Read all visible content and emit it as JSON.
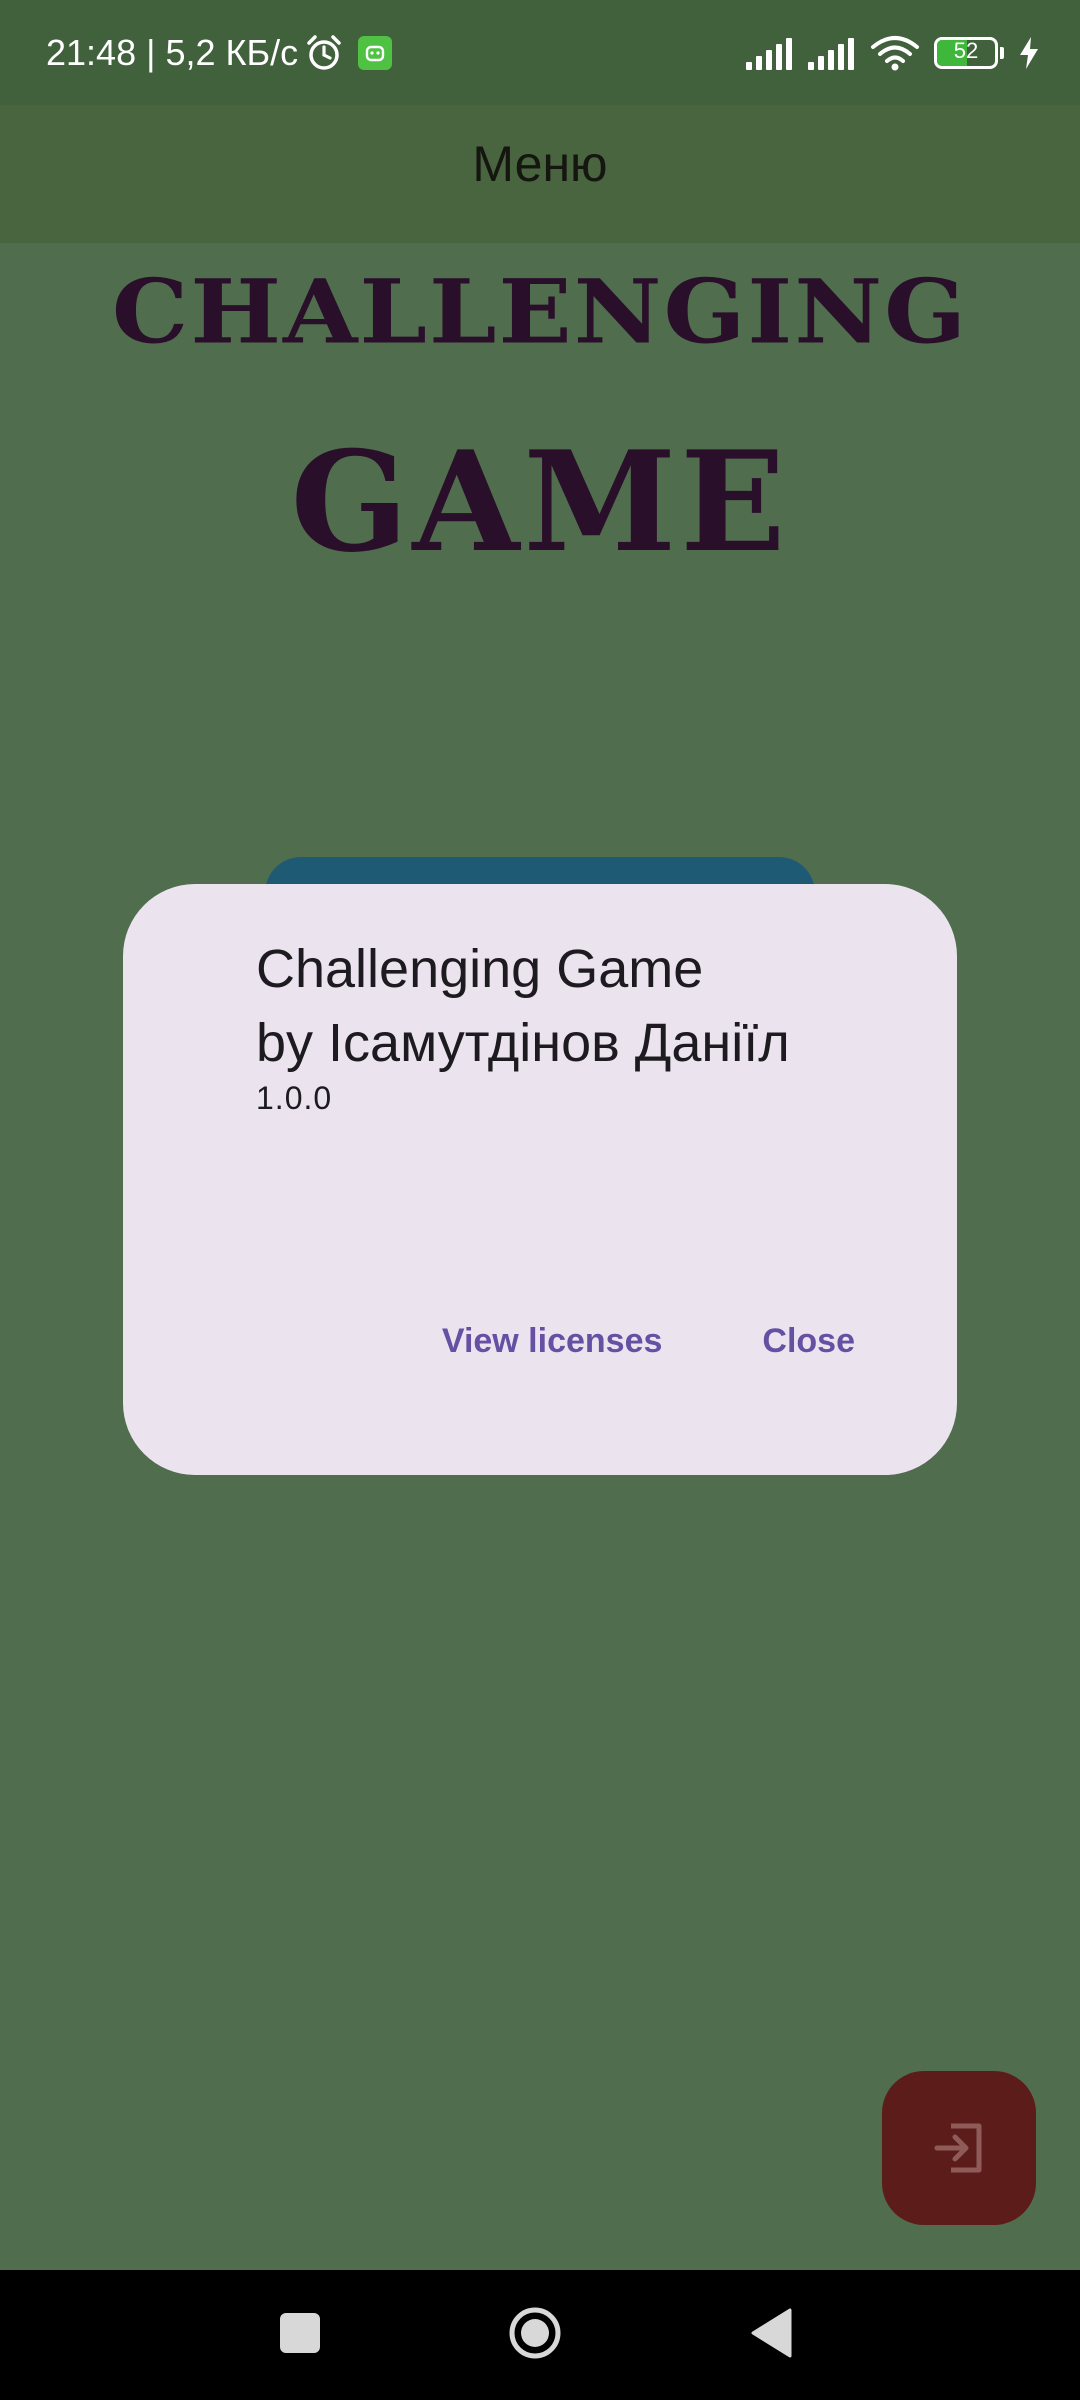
{
  "status_bar": {
    "time_and_speed": "21:48 | 5,2 КБ/с",
    "battery_level": "52",
    "battery_fraction": 0.52,
    "icons": [
      "alarm-icon",
      "app-notification-icon",
      "signal-icon",
      "signal-icon",
      "wifi-icon",
      "battery-icon",
      "charging-icon"
    ]
  },
  "app_bar": {
    "title": "Меню"
  },
  "logo": {
    "line1": "CHALLENGING",
    "line2": "GAME"
  },
  "dialog": {
    "title_line1": "Challenging Game",
    "title_line2": "by Ісамутдінов Даніїл",
    "version": "1.0.0",
    "view_licenses_label": "View licenses",
    "close_label": "Close"
  },
  "fab": {
    "icon": "exit-icon"
  },
  "nav_bar": {
    "icons": [
      "recents-icon",
      "home-icon",
      "back-icon"
    ]
  },
  "colors": {
    "background": "#506d4e",
    "app_bar": "#48653f",
    "dialog_bg": "#ebe4ef",
    "dialog_action": "#6650a4",
    "logo": "#2a0f2b",
    "fab": "#5c1c1a",
    "start_button": "#1f5a75"
  }
}
